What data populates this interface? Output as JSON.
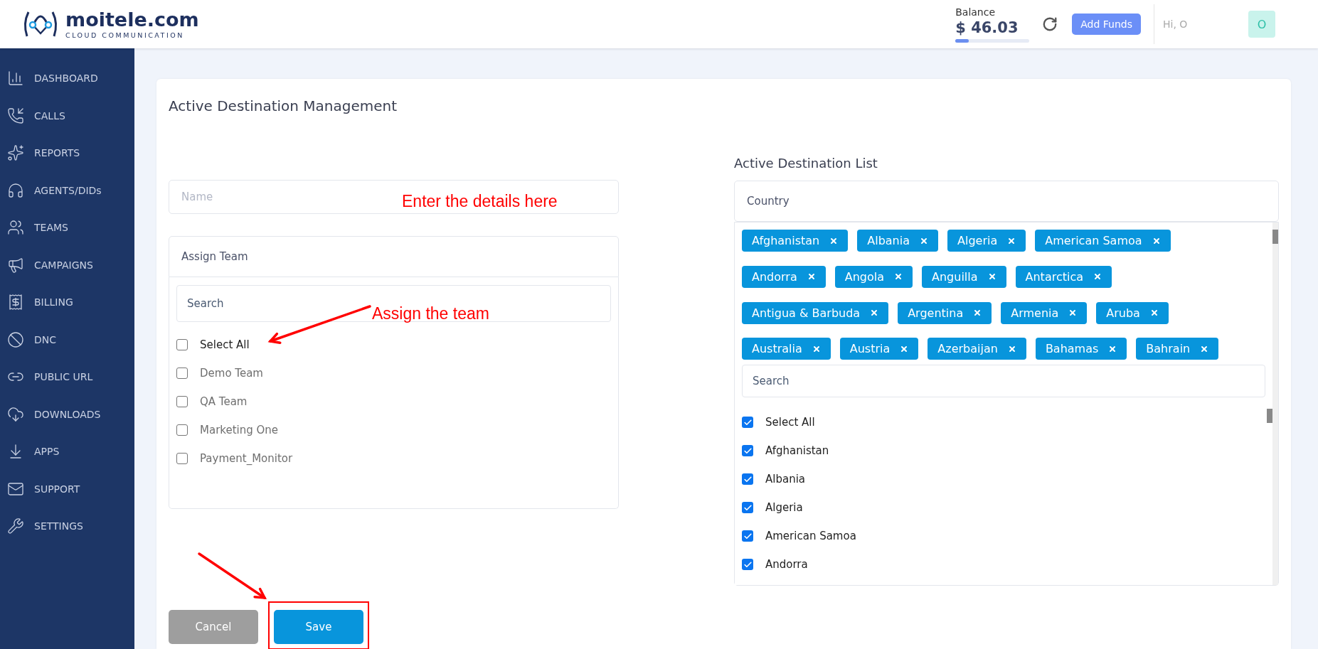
{
  "header": {
    "logo": {
      "name": "moitele.com",
      "tagline": "CLOUD COMMUNICATION"
    },
    "balance": {
      "label": "Balance",
      "amount": "$ 46.03",
      "level": 0.18
    },
    "add_funds": "Add Funds",
    "greeting": "Hi, O",
    "avatar": "O"
  },
  "sidebar": {
    "items": [
      {
        "label": "DASHBOARD"
      },
      {
        "label": "CALLS"
      },
      {
        "label": "REPORTS"
      },
      {
        "label": "AGENTS/DIDs"
      },
      {
        "label": "TEAMS"
      },
      {
        "label": "CAMPAIGNS"
      },
      {
        "label": "BILLING"
      },
      {
        "label": "DNC"
      },
      {
        "label": "PUBLIC URL"
      },
      {
        "label": "DOWNLOADS"
      },
      {
        "label": "APPS"
      },
      {
        "label": "SUPPORT"
      },
      {
        "label": "SETTINGS"
      }
    ]
  },
  "page": {
    "title": "Active Destination Management",
    "name_field": {
      "placeholder": "Name"
    },
    "assign_team": {
      "label": "Assign Team",
      "search_placeholder": "Search",
      "options": [
        {
          "label": "Select All",
          "checked": false,
          "kind": "all"
        },
        {
          "label": "Demo Team",
          "checked": false,
          "kind": "item"
        },
        {
          "label": "QA Team",
          "checked": false,
          "kind": "item"
        },
        {
          "label": "Marketing One",
          "checked": false,
          "kind": "item"
        },
        {
          "label": "Payment_Monitor",
          "checked": false,
          "kind": "item"
        }
      ]
    },
    "destination_list": {
      "title": "Active Destination List",
      "field_label": "Country",
      "tags": [
        "Afghanistan",
        "Albania",
        "Algeria",
        "American Samoa",
        "Andorra",
        "Angola",
        "Anguilla",
        "Antarctica",
        "Antigua & Barbuda",
        "Argentina",
        "Armenia",
        "Aruba",
        "Australia",
        "Austria",
        "Azerbaijan",
        "Bahamas",
        "Bahrain"
      ],
      "search_placeholder": "Search",
      "options": [
        {
          "label": "Select All",
          "checked": true
        },
        {
          "label": "Afghanistan",
          "checked": true
        },
        {
          "label": "Albania",
          "checked": true
        },
        {
          "label": "Algeria",
          "checked": true
        },
        {
          "label": "American Samoa",
          "checked": true
        },
        {
          "label": "Andorra",
          "checked": true
        }
      ]
    },
    "buttons": [
      {
        "label": "Cancel",
        "kind": "secondary",
        "highlighted": false
      },
      {
        "label": "Save",
        "kind": "primary",
        "highlighted": true
      }
    ]
  },
  "annotations": [
    {
      "text": "Enter the details here"
    },
    {
      "text": "Assign the team"
    }
  ]
}
